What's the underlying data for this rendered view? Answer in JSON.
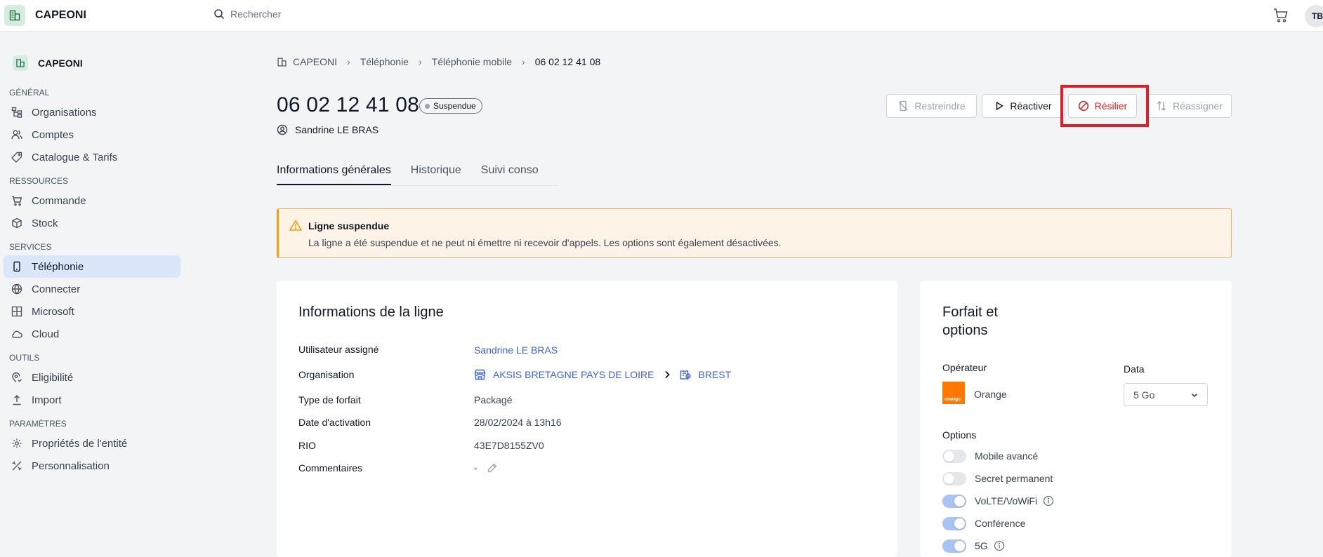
{
  "app": {
    "name": "CAPEONI",
    "user_initials": "TB"
  },
  "search": {
    "placeholder": "Rechercher"
  },
  "sidebar": {
    "org": "CAPEONI",
    "sections": [
      {
        "title": "GÉNÉRAL",
        "items": [
          "Organisations",
          "Comptes",
          "Catalogue & Tarifs"
        ]
      },
      {
        "title": "RESSOURCES",
        "items": [
          "Commande",
          "Stock"
        ]
      },
      {
        "title": "SERVICES",
        "items": [
          "Téléphonie",
          "Connecter",
          "Microsoft",
          "Cloud"
        ]
      },
      {
        "title": "OUTILS",
        "items": [
          "Eligibilité",
          "Import"
        ]
      },
      {
        "title": "PARAMÈTRES",
        "items": [
          "Propriétés de l'entité",
          "Personnalisation"
        ]
      }
    ],
    "active": "Téléphonie"
  },
  "breadcrumb": [
    "CAPEONI",
    "Téléphonie",
    "Téléphonie mobile",
    "06 02 12 41 08"
  ],
  "header": {
    "title": "06 02 12 41 08",
    "status": "Suspendue",
    "user": "Sandrine LE BRAS"
  },
  "actions": {
    "restrict": "Restreindre",
    "reactivate": "Réactiver",
    "terminate": "Résilier",
    "reassign": "Réassigner"
  },
  "tabs": [
    "Informations générales",
    "Historique",
    "Suivi conso"
  ],
  "alert": {
    "title": "Ligne suspendue",
    "text": "La ligne a été suspendue et ne peut ni émettre ni recevoir d'appels. Les options sont également désactivées."
  },
  "line_info": {
    "title": "Informations de la ligne",
    "rows": {
      "user_label": "Utilisateur assigné",
      "user_value": "Sandrine LE BRAS",
      "org_label": "Organisation",
      "org_parent": "AKSIS BRETAGNE PAYS DE LOIRE",
      "org_child": "BREST",
      "plan_label": "Type de forfait",
      "plan_value": "Packagé",
      "activation_label": "Date d'activation",
      "activation_value": "28/02/2024 à 13h16",
      "rio_label": "RIO",
      "rio_value": "43E7D8155ZV0",
      "comments_label": "Commentaires",
      "comments_value": "-"
    }
  },
  "plan": {
    "title_line1": "Forfait et",
    "title_line2": "options",
    "operator_label": "Opérateur",
    "operator_name": "Orange",
    "operator_logo_text": "orange",
    "data_label": "Data",
    "data_value": "5 Go",
    "options_label": "Options",
    "options": [
      {
        "name": "Mobile avancé",
        "on": false,
        "info": false
      },
      {
        "name": "Secret permanent",
        "on": false,
        "info": false
      },
      {
        "name": "VoLTE/VoWiFi",
        "on": true,
        "info": true
      },
      {
        "name": "Conférence",
        "on": true,
        "info": false
      },
      {
        "name": "5G",
        "on": true,
        "info": true
      }
    ]
  },
  "colors": {
    "accent": "#3b63d9",
    "danger": "#dc2626",
    "active_nav": "#dbe6fb",
    "alert_bg": "#fef3e7"
  }
}
